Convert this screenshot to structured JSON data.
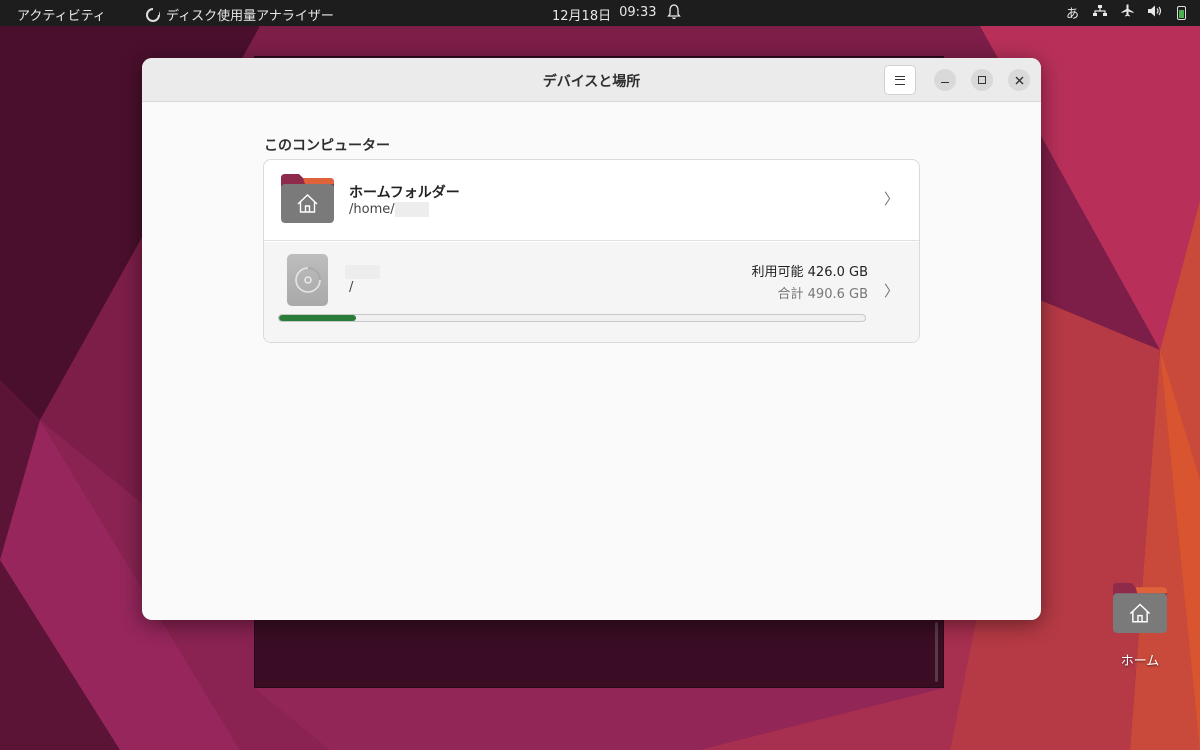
{
  "topbar": {
    "activities": "アクティビティ",
    "app_name": "ディスク使用量アナライザー",
    "date": "12月18日",
    "time": "09:33",
    "input_method": "あ"
  },
  "window": {
    "title": "デバイスと場所",
    "section_title": "このコンピューター",
    "home": {
      "name": "ホームフォルダー",
      "path": "/home/"
    },
    "disk": {
      "mount": "/",
      "available": "利用可能 426.0 GB",
      "total": "合計 490.6 GB",
      "used_fraction": 0.132
    }
  },
  "desktop": {
    "home_label": "ホーム"
  },
  "colors": {
    "usage_bar": "#2a7d39",
    "folder_tab": "#8e2a4a",
    "folder_body": "#7a7a7a"
  }
}
